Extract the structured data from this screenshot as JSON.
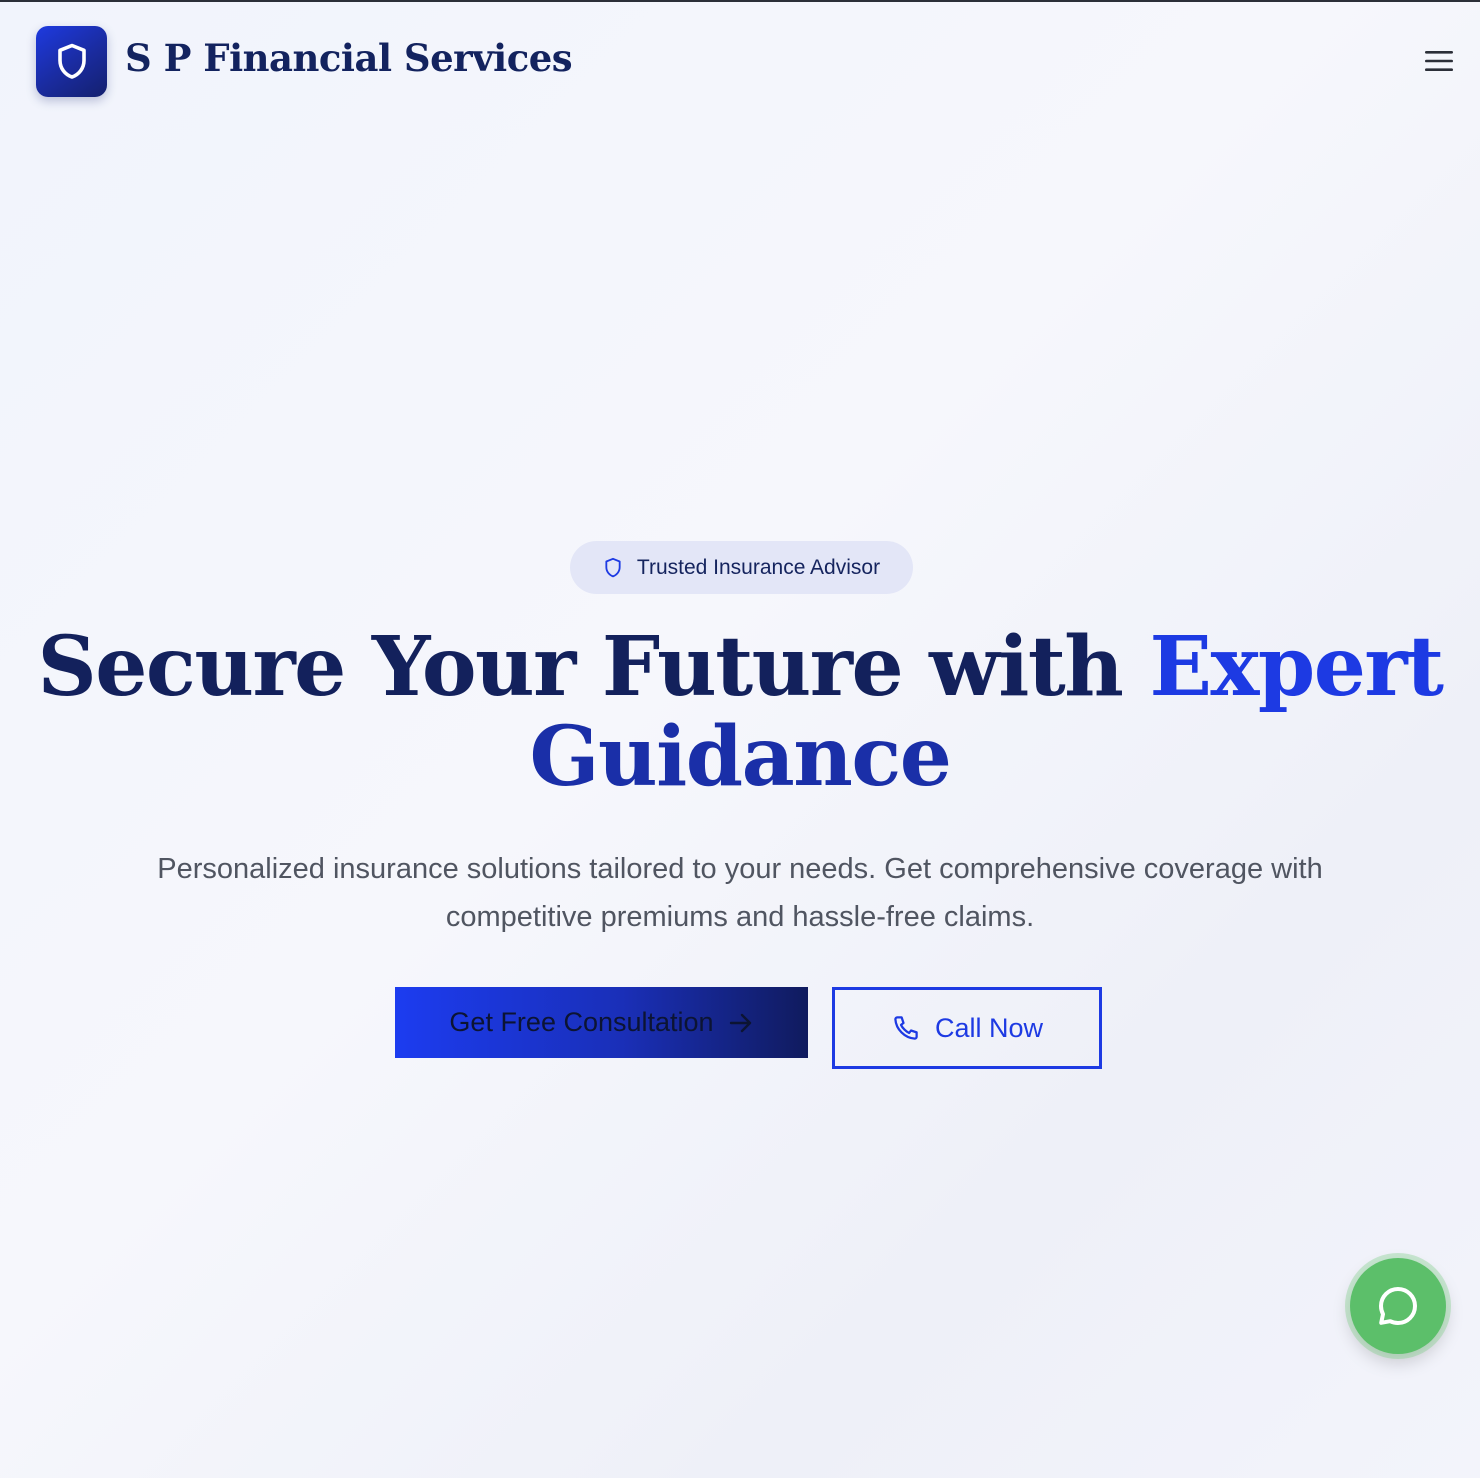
{
  "header": {
    "brand_name": "S P Financial Services",
    "logo_icon": "shield-icon",
    "menu_icon": "hamburger-menu-icon"
  },
  "hero": {
    "badge_text": "Trusted Insurance Advisor",
    "title_part1": "Secure Your Future with ",
    "title_accent1": "Expert",
    "title_accent2": "Guidance",
    "subtitle": "Personalized insurance solutions tailored to your needs. Get comprehensive coverage with competitive premiums and hassle-free claims.",
    "primary_button_label": "Get Free Consultation",
    "secondary_button_label": "Call Now"
  },
  "chat": {
    "icon": "chat-bubble-icon"
  },
  "colors": {
    "brand_navy": "#13215c",
    "accent_blue": "#1d3ae3",
    "chat_green": "#5cbf6a",
    "badge_bg": "#e3e6f7"
  }
}
